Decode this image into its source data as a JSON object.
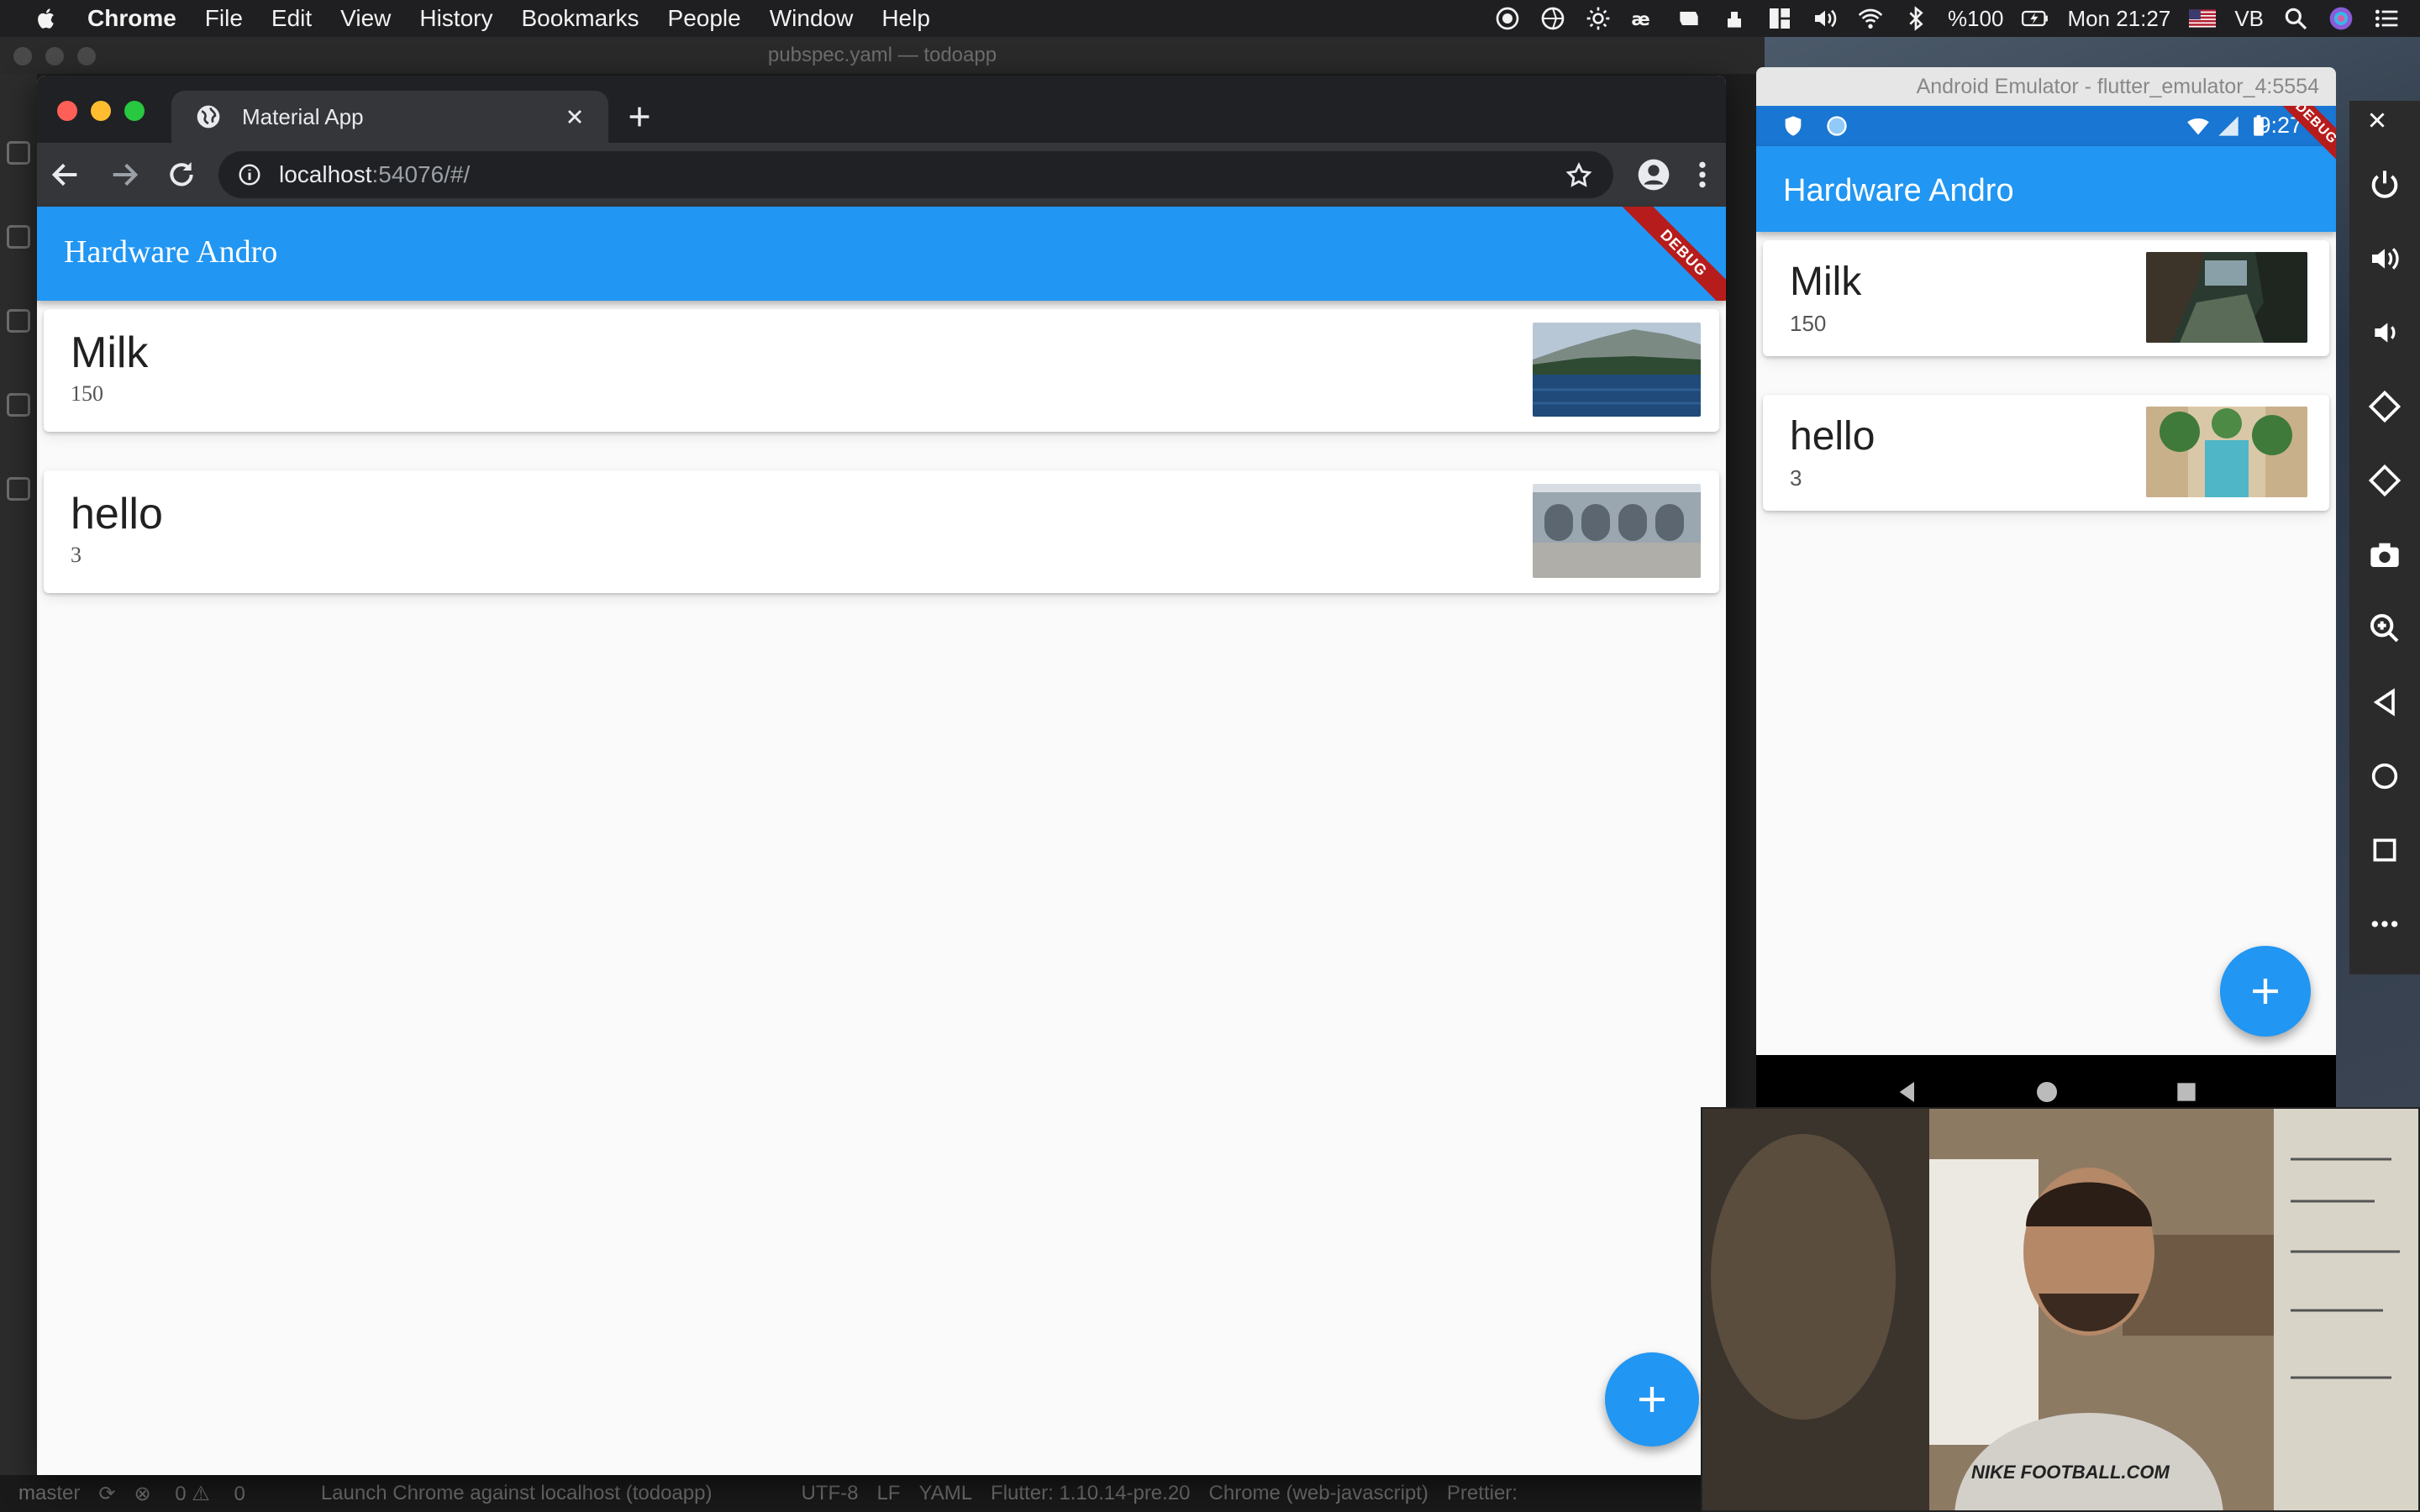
{
  "menubar": {
    "app_name": "Chrome",
    "menus": [
      "File",
      "Edit",
      "View",
      "History",
      "Bookmarks",
      "People",
      "Window",
      "Help"
    ],
    "battery": "%100",
    "clock": "Mon 21:27",
    "input_source": "VB"
  },
  "vscode": {
    "window_title": "pubspec.yaml — todoapp",
    "status": {
      "branch": "master",
      "problems": "0",
      "warnings": "0",
      "launch": "Launch Chrome against localhost (todoapp)",
      "encoding": "UTF-8",
      "eol": "LF",
      "language": "YAML",
      "flutter": "Flutter: 1.10.14-pre.20",
      "device": "Chrome (web-javascript)",
      "prettier": "Prettier:"
    }
  },
  "chrome": {
    "tab_title": "Material App",
    "url_host": "localhost",
    "url_path": ":54076/#/",
    "colors": {
      "frame": "#202124",
      "toolbar": "#35363a"
    }
  },
  "web_app": {
    "title": "Hardware Andro",
    "debug_label": "DEBUG",
    "items": [
      {
        "name": "Milk",
        "qty": "150",
        "image": "lake-landscape"
      },
      {
        "name": "hello",
        "qty": "3",
        "image": "building-arches"
      }
    ],
    "fab_icon": "plus-icon",
    "colors": {
      "primary": "#2196f3"
    }
  },
  "emulator": {
    "window_title": "Android Emulator - flutter_emulator_4:5554",
    "status_time": "9:27",
    "app_title": "Hardware Andro",
    "debug_label": "DEBUG",
    "items": [
      {
        "name": "Milk",
        "qty": "150",
        "image": "rocky-coast"
      },
      {
        "name": "hello",
        "qty": "3",
        "image": "hotel-pool"
      }
    ],
    "fab_icon": "plus-icon",
    "side_tools": [
      "power-icon",
      "volume-up-icon",
      "volume-down-icon",
      "rotate-left-icon",
      "rotate-right-icon",
      "camera-icon",
      "zoom-icon",
      "back-icon",
      "home-icon",
      "overview-icon",
      "more-icon"
    ]
  },
  "webcam": {
    "shirt_text": "NIKE FOOTBALL.COM"
  }
}
